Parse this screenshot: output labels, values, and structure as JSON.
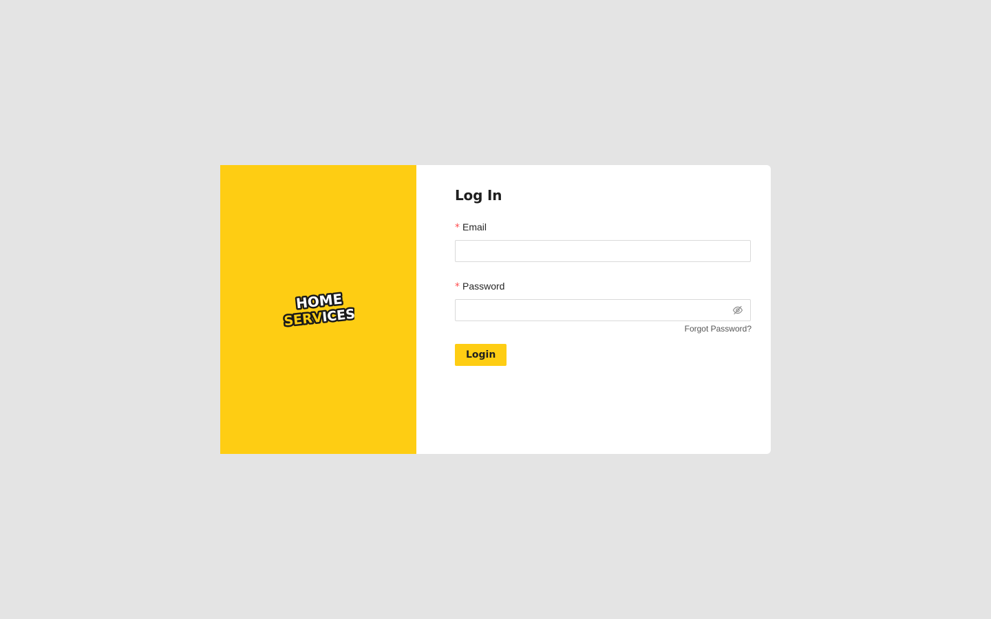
{
  "brand": {
    "logo_line1": "HOME",
    "logo_line2": "SERVICES",
    "logo_icon": "home-services-logo"
  },
  "form": {
    "title": "Log In",
    "email": {
      "label": "Email",
      "required_mark": "*",
      "value": "",
      "placeholder": ""
    },
    "password": {
      "label": "Password",
      "required_mark": "*",
      "value": "",
      "placeholder": "",
      "toggle_icon": "eye-invisible-icon"
    },
    "forgot_password_label": "Forgot Password?",
    "submit_label": "Login"
  },
  "colors": {
    "brand_yellow": "#fecd13",
    "background": "#e4e4e4",
    "required": "#ff4d4f"
  }
}
